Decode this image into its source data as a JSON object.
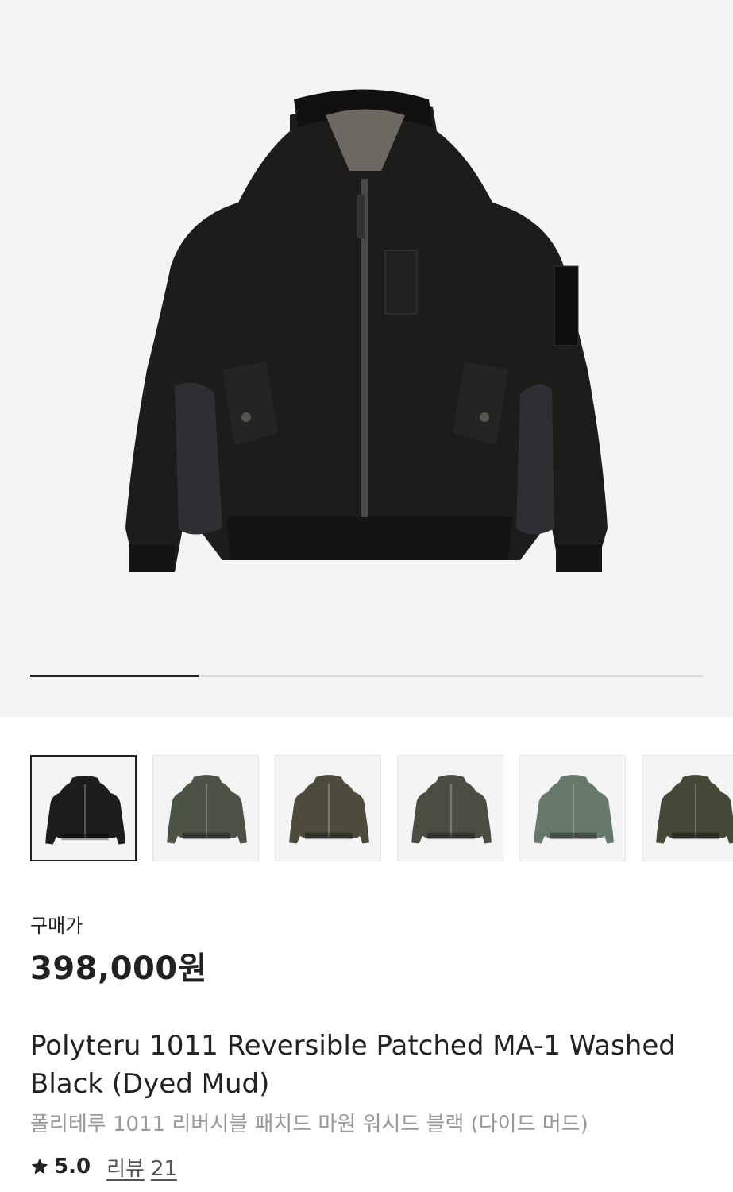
{
  "gallery": {
    "current_slide": 1,
    "total_slides": 4,
    "thumbnails": [
      {
        "variant": "washed-black",
        "color": "#1d1d1b",
        "selected": true
      },
      {
        "variant": "olive-1",
        "color": "#4b5346",
        "selected": false
      },
      {
        "variant": "olive-2",
        "color": "#4c4b3c",
        "selected": false
      },
      {
        "variant": "olive-3",
        "color": "#4a4e42",
        "selected": false
      },
      {
        "variant": "sage",
        "color": "#66786a",
        "selected": false
      },
      {
        "variant": "olive-4",
        "color": "#434837",
        "selected": false
      }
    ]
  },
  "product": {
    "price_label": "구매가",
    "price": "398,000원",
    "title_en": "Polyteru 1011 Reversible Patched MA-1 Washed Black (Dyed Mud)",
    "title_ko": "폴리테루 1011 리버시블 패치드 마원 워시드 블랙 (다이드 머드)",
    "rating": "5.0",
    "review_label": "리뷰",
    "review_count": "21"
  },
  "colors": {
    "accent": "#222222",
    "muted": "#999999",
    "background": "#f4f4f4"
  }
}
